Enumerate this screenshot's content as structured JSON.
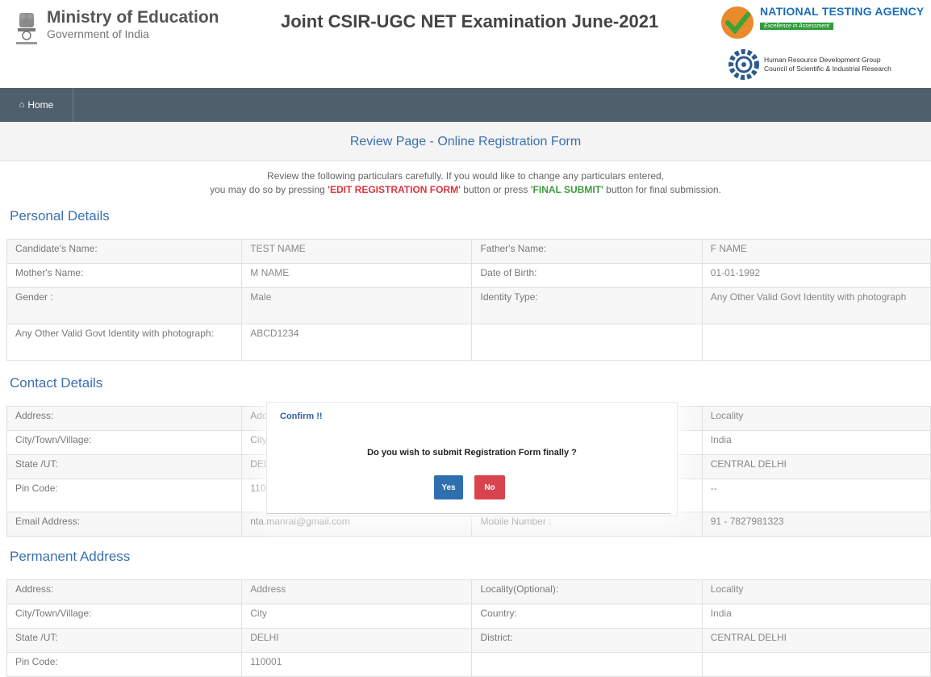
{
  "header": {
    "ministry_title": "Ministry of Education",
    "ministry_sub": "Government of India",
    "exam_title": "Joint CSIR-UGC NET Examination June-2021",
    "nta_title": "NATIONAL TESTING AGENCY",
    "nta_tagline": "Excellence in Assessment",
    "hrdg_line1": "Human Resource Development Group",
    "hrdg_line2": "Council of Scientific & Industrial Research"
  },
  "nav": {
    "home_icon": "home-icon",
    "home_label": "Home"
  },
  "review": {
    "title": "Review Page - Online Registration Form",
    "line1": "Review the following particulars carefully. If you would like to change any particulars entered,",
    "line2_pre": "you may do so by pressing ",
    "edit_label": "'EDIT REGISTRATION FORM'",
    "line2_mid": " button or press ",
    "submit_label": "'FINAL SUBMIT'",
    "line2_post": " button for final submission."
  },
  "personal": {
    "title": "Personal Details",
    "rows": [
      [
        "Candidate's Name:",
        "TEST NAME",
        "Father's Name:",
        "F NAME"
      ],
      [
        "Mother's Name:",
        "M NAME",
        "Date of Birth:",
        "01-01-1992"
      ],
      [
        "Gender :",
        "Male",
        "Identity Type:",
        "Any Other Valid Govt Identity with photograph"
      ],
      [
        "Any Other Valid Govt Identity with photograph:",
        "ABCD1234",
        "",
        ""
      ]
    ]
  },
  "contact": {
    "title": "Contact Details",
    "rows": [
      [
        "Address:",
        "Add",
        "",
        "Locality"
      ],
      [
        "City/Town/Village:",
        "City",
        "",
        "India"
      ],
      [
        "State /UT:",
        "DEL",
        "",
        "CENTRAL DELHI"
      ],
      [
        "Pin Code:",
        "110",
        "",
        "--"
      ],
      [
        "Email Address:",
        "nta.manral@gmail.com",
        "Mobile Number :",
        "91 - 7827981323"
      ]
    ]
  },
  "permanent": {
    "title": "Permanent Address",
    "rows": [
      [
        "Address:",
        "Address",
        "Locality(Optional):",
        "Locality"
      ],
      [
        "City/Town/Village:",
        "City",
        "Country:",
        "India"
      ],
      [
        "State /UT:",
        "DELHI",
        "District:",
        "CENTRAL DELHI"
      ],
      [
        "Pin Code:",
        "110001",
        "",
        ""
      ]
    ]
  },
  "dialog": {
    "title": "Confirm !!",
    "message": "Do you wish to submit Registration Form finally ?",
    "yes_label": "Yes",
    "no_label": "No"
  },
  "colors": {
    "nav_bg": "#505f6c",
    "accent_blue": "#3b6fb0",
    "yes_btn": "#2f6faf",
    "no_btn": "#d9434e",
    "edit_red": "#d9363e",
    "submit_green": "#3e9a3e"
  }
}
